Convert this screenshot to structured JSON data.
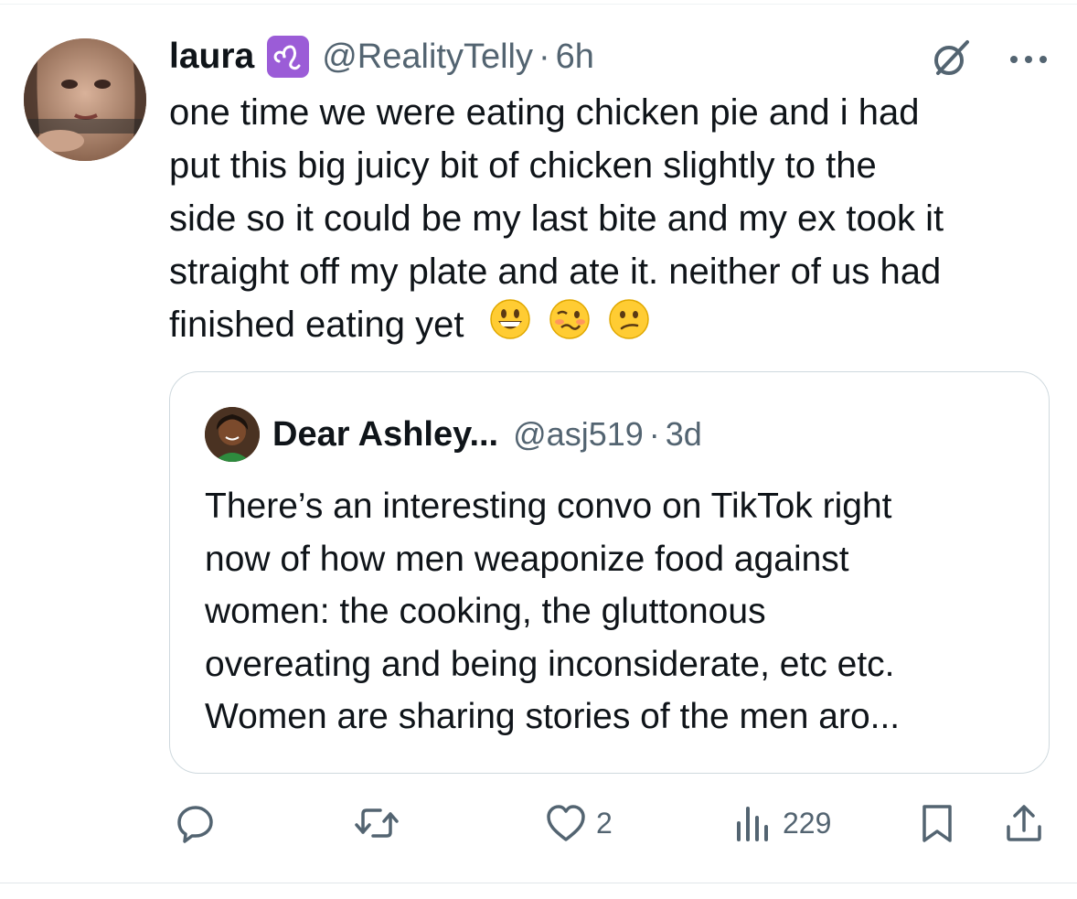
{
  "author": {
    "name": "laura",
    "badge_icon": "leo-zodiac-icon",
    "badge_color": "#9b5cd7",
    "handle": "@RealityTelly",
    "time": "6h"
  },
  "tweet": {
    "lines": [
      "one time we were eating chicken pie and i had",
      "put this big juicy bit of chicken slightly to the",
      "side so it could be my last bite and my ex took it",
      "straight off my plate and ate it. neither of us had",
      "finished eating yet"
    ],
    "emojis": [
      "grinning-face-emoji",
      "woozy-face-emoji",
      "confused-face-emoji"
    ]
  },
  "quote": {
    "name": "Dear Ashley...",
    "handle": "@asj519",
    "time": "3d",
    "lines": [
      "There’s an interesting convo on TikTok right",
      "now of how men weaponize food against",
      "women: the cooking, the gluttonous",
      "overeating and being inconsiderate, etc etc.",
      "Women are sharing stories of the men aro..."
    ]
  },
  "actions": {
    "reply_count": "",
    "retweet_count": "",
    "like_count": "2",
    "views_count": "229"
  },
  "colors": {
    "text": "#0f1419",
    "secondary": "#536471",
    "border": "#cfd9de"
  }
}
